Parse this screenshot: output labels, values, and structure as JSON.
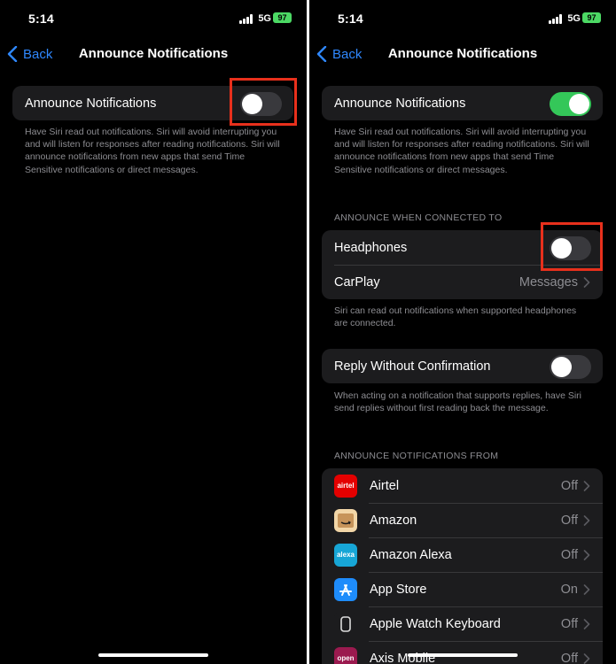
{
  "left": {
    "status": {
      "time": "5:14",
      "network": "5G",
      "battery": "97"
    },
    "nav": {
      "back": "Back",
      "title": "Announce Notifications"
    },
    "announce": {
      "label": "Announce Notifications",
      "on": false
    },
    "description": "Have Siri read out notifications. Siri will avoid interrupting you and will listen for responses after reading notifications. Siri will announce notifications from new apps that send Time Sensitive notifications or direct messages."
  },
  "right": {
    "status": {
      "time": "5:14",
      "network": "5G",
      "battery": "97"
    },
    "nav": {
      "back": "Back",
      "title": "Announce Notifications"
    },
    "announce": {
      "label": "Announce Notifications",
      "on": true
    },
    "description": "Have Siri read out notifications. Siri will avoid interrupting you and will listen for responses after reading notifications. Siri will announce notifications from new apps that send Time Sensitive notifications or direct messages.",
    "connected_header": "ANNOUNCE WHEN CONNECTED TO",
    "headphones": {
      "label": "Headphones",
      "on": false
    },
    "carplay": {
      "label": "CarPlay",
      "value": "Messages"
    },
    "connected_footer": "Siri can read out notifications when supported headphones are connected.",
    "reply": {
      "label": "Reply Without Confirmation",
      "on": false
    },
    "reply_footer": "When acting on a notification that supports replies, have Siri send replies without first reading back the message.",
    "apps_header": "ANNOUNCE NOTIFICATIONS FROM",
    "apps": [
      {
        "name": "Airtel",
        "value": "Off",
        "icon": "airtel-icon",
        "icon_text": "airtel",
        "color": "#e40000"
      },
      {
        "name": "Amazon",
        "value": "Off",
        "icon": "amazon-icon",
        "icon_text": "",
        "color": "#f2d6a7"
      },
      {
        "name": "Amazon Alexa",
        "value": "Off",
        "icon": "alexa-icon",
        "icon_text": "alexa",
        "color": "#17a6d6"
      },
      {
        "name": "App Store",
        "value": "On",
        "icon": "app-store-icon",
        "icon_text": "",
        "color": "#1e8cfb"
      },
      {
        "name": "Apple Watch Keyboard",
        "value": "Off",
        "icon": "apple-watch-keyboard-icon",
        "icon_text": "",
        "color": "#1c1c1e"
      },
      {
        "name": "Axis Mobile",
        "value": "Off",
        "icon": "axis-mobile-icon",
        "icon_text": "open",
        "color": "#9b1a4f"
      }
    ]
  },
  "colors": {
    "accent": "#2f88ff",
    "toggle_on": "#34c759",
    "highlight": "#e8301c"
  }
}
